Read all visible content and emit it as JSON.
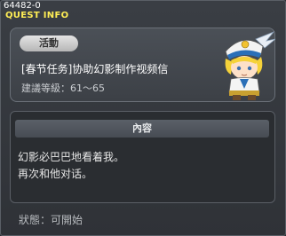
{
  "window": {
    "quest_id": "64482-0",
    "title": "QUEST INFO"
  },
  "quest": {
    "status_tag": "活動",
    "name": "[春节任务]协助幻影制作视频信",
    "level_label": "建議等級：",
    "level_range": "61～65",
    "portrait_icon": "blonde-captain-npc-portrait"
  },
  "content": {
    "header": "內容",
    "lines": [
      "幻影必巴巴地看着我。",
      "再次和他对话。"
    ]
  },
  "state": {
    "label": "狀態：",
    "value": "可開始"
  },
  "colors": {
    "title": "#ffee55",
    "background": "#2b2e33"
  }
}
